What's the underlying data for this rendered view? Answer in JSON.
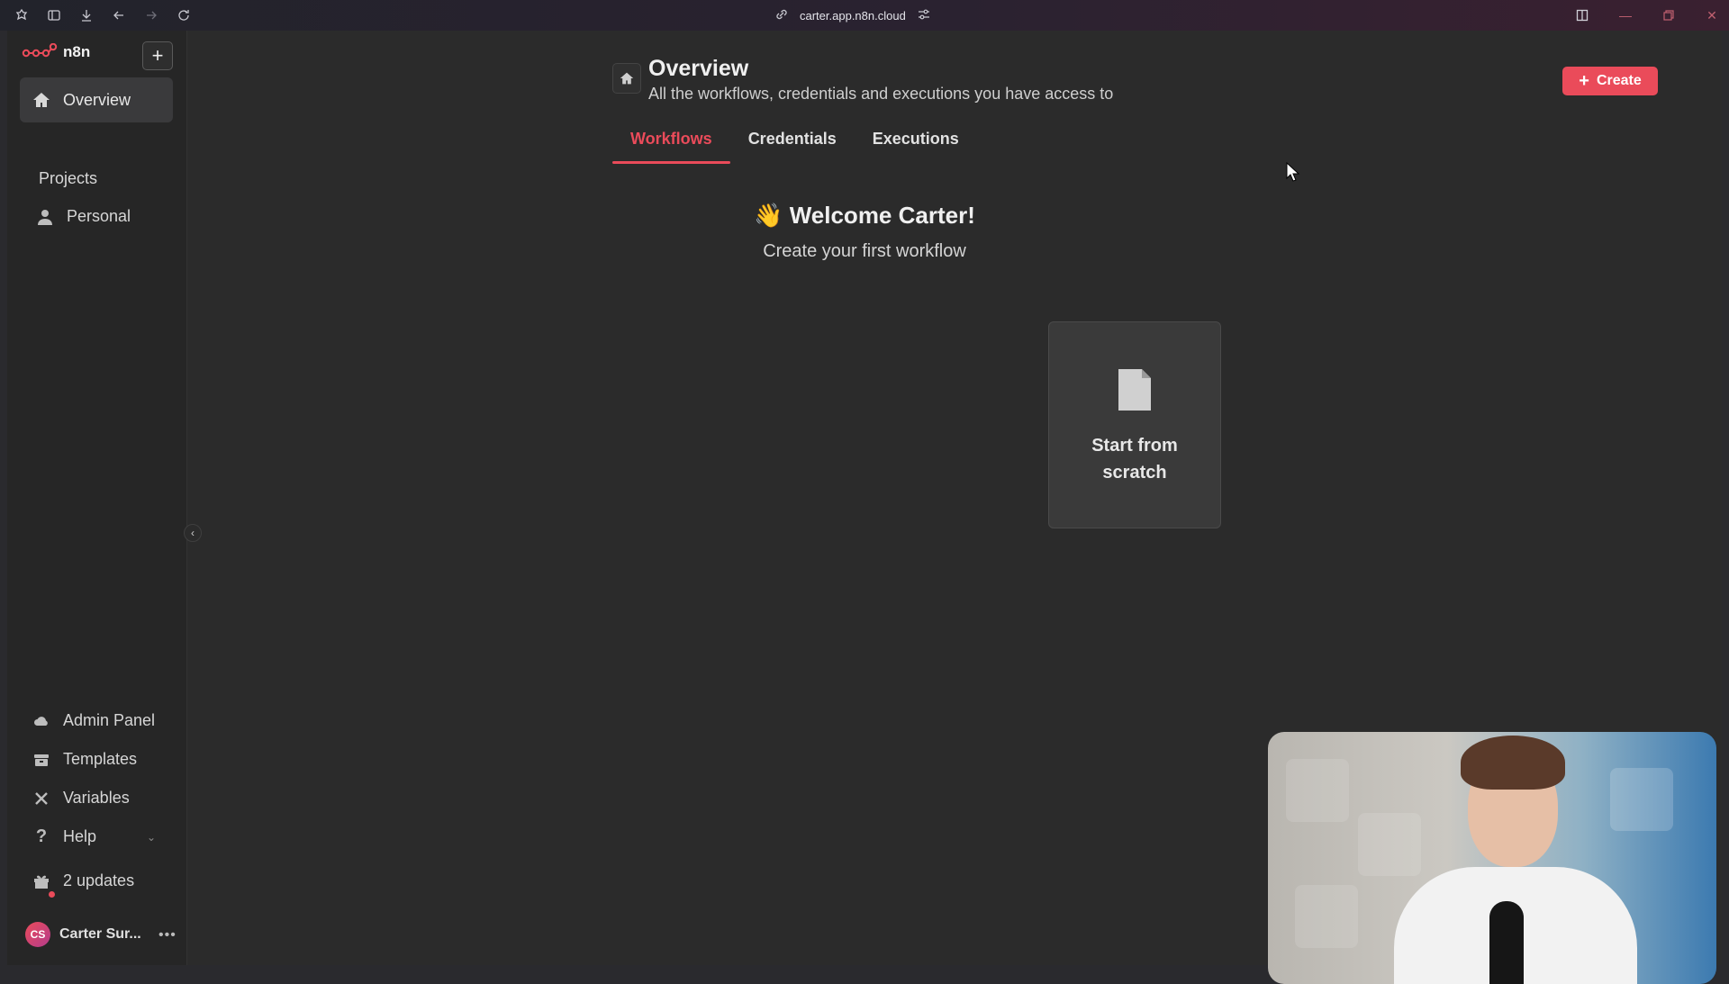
{
  "browser": {
    "url": "carter.app.n8n.cloud"
  },
  "sidebar": {
    "brand": "n8n",
    "overview_label": "Overview",
    "projects_label": "Projects",
    "personal_label": "Personal",
    "bottom_items": [
      {
        "label": "Admin Panel",
        "icon": "cloud-icon"
      },
      {
        "label": "Templates",
        "icon": "templates-icon"
      },
      {
        "label": "Variables",
        "icon": "variables-icon"
      },
      {
        "label": "Help",
        "icon": "help-icon"
      },
      {
        "label": "2 updates",
        "icon": "gift-icon"
      }
    ],
    "user": {
      "initials": "CS",
      "name": "Carter Sur..."
    }
  },
  "header": {
    "title": "Overview",
    "subtitle": "All the workflows, credentials and executions you have access to",
    "create_label": "Create"
  },
  "tabs": [
    {
      "label": "Workflows",
      "active": true
    },
    {
      "label": "Credentials",
      "active": false
    },
    {
      "label": "Executions",
      "active": false
    }
  ],
  "empty_state": {
    "welcome": "👋 Welcome Carter!",
    "subtitle": "Create your first workflow",
    "card_label": "Start from scratch"
  },
  "colors": {
    "accent": "#ea4b5a",
    "background": "#2b2b2b",
    "sidebar": "#262626"
  }
}
